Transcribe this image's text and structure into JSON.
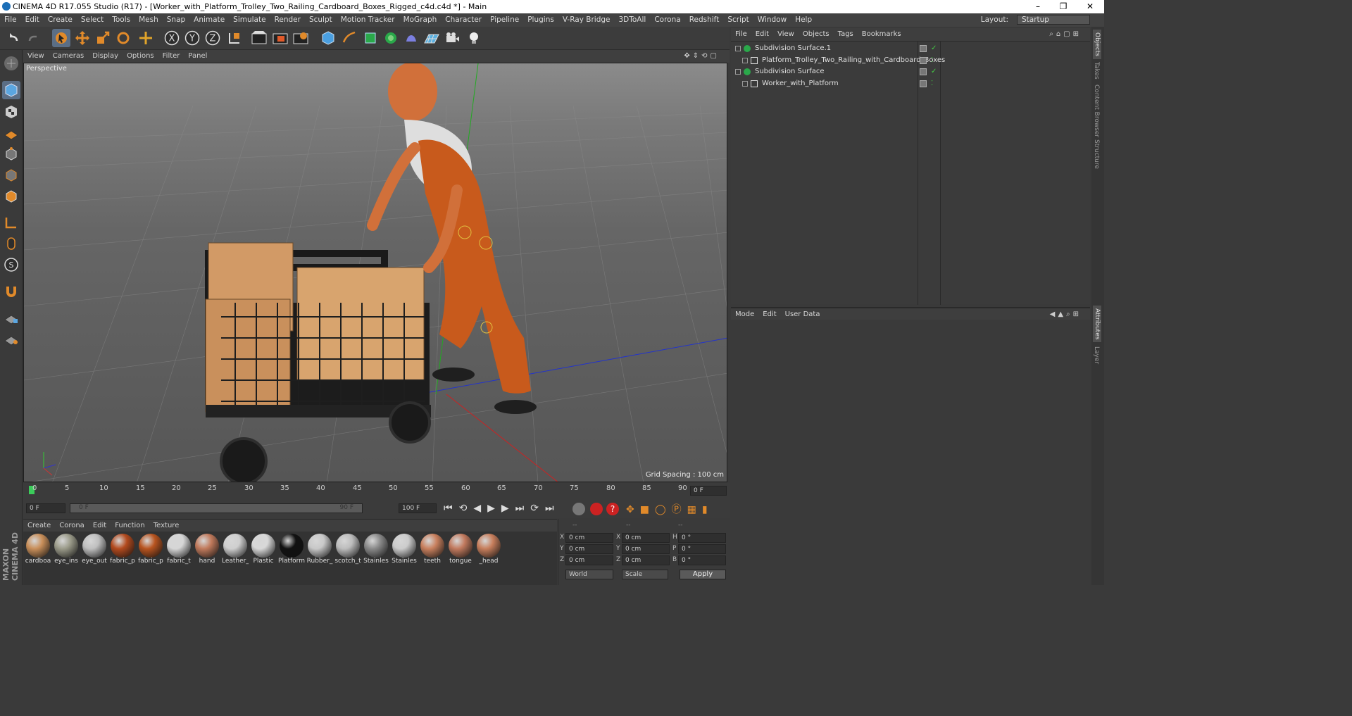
{
  "window": {
    "title": "CINEMA 4D R17.055 Studio (R17) - [Worker_with_Platform_Trolley_Two_Railing_Cardboard_Boxes_Rigged_c4d.c4d *] - Main",
    "minimize": "–",
    "maximize": "❐",
    "close": "✕"
  },
  "menu": [
    "File",
    "Edit",
    "Create",
    "Select",
    "Tools",
    "Mesh",
    "Snap",
    "Animate",
    "Simulate",
    "Render",
    "Sculpt",
    "Motion Tracker",
    "MoGraph",
    "Character",
    "Pipeline",
    "Plugins",
    "V-Ray Bridge",
    "3DToAll",
    "Corona",
    "Redshift",
    "Script",
    "Window",
    "Help"
  ],
  "layout": {
    "label": "Layout:",
    "value": "Startup"
  },
  "toolbar": {
    "x": "X",
    "y": "Y",
    "z": "Z"
  },
  "viewport": {
    "menu": [
      "View",
      "Cameras",
      "Display",
      "Options",
      "Filter",
      "Panel"
    ],
    "label": "Perspective",
    "grid_spacing": "Grid Spacing : 100 cm"
  },
  "timeline": {
    "ticks": [
      "0",
      "5",
      "10",
      "15",
      "20",
      "25",
      "30",
      "35",
      "40",
      "45",
      "50",
      "55",
      "60",
      "65",
      "70",
      "75",
      "80",
      "85",
      "90"
    ],
    "current": "0 F"
  },
  "transport": {
    "start": "0 F",
    "range_start": "0 F",
    "range_end": "90 F",
    "end": "100 F"
  },
  "materials": {
    "menu": [
      "Create",
      "Corona",
      "Edit",
      "Function",
      "Texture"
    ],
    "items": [
      {
        "name": "cardboa",
        "color": "#c98f5a"
      },
      {
        "name": "eye_ins",
        "color": "#9b9b8a"
      },
      {
        "name": "eye_out",
        "color": "#bfbfbf"
      },
      {
        "name": "fabric_p",
        "color": "#b34a1e"
      },
      {
        "name": "fabric_p",
        "color": "#b8541f"
      },
      {
        "name": "fabric_t",
        "color": "#d6d6d6"
      },
      {
        "name": "hand",
        "color": "#c17a5c"
      },
      {
        "name": "Leather_",
        "color": "#cfcfcf"
      },
      {
        "name": "Plastic",
        "color": "#d8d8d8"
      },
      {
        "name": "Platform",
        "color": "#111111"
      },
      {
        "name": "Rubber_",
        "color": "#c8c8c8"
      },
      {
        "name": "scotch_t",
        "color": "#bdbdbd"
      },
      {
        "name": "Stainles",
        "color": "#8a8a8a"
      },
      {
        "name": "Stainles",
        "color": "#cccccc"
      },
      {
        "name": "teeth",
        "color": "#c9805e"
      },
      {
        "name": "tongue",
        "color": "#c27a5e"
      },
      {
        "name": "_head",
        "color": "#c77e5c"
      }
    ]
  },
  "coords": {
    "header": [
      "--",
      "--",
      "--"
    ],
    "rows": [
      [
        "X",
        "0 cm",
        "X",
        "0 cm",
        "H",
        "0 °"
      ],
      [
        "Y",
        "0 cm",
        "Y",
        "0 cm",
        "P",
        "0 °"
      ],
      [
        "Z",
        "0 cm",
        "Z",
        "0 cm",
        "B",
        "0 °"
      ]
    ],
    "world": "World",
    "scale": "Scale",
    "apply": "Apply"
  },
  "objects": {
    "menu": [
      "File",
      "Edit",
      "View",
      "Objects",
      "Tags",
      "Bookmarks"
    ],
    "rows": [
      {
        "name": "Subdivision Surface.1",
        "indent": 0,
        "type": "subdiv"
      },
      {
        "name": "Platform_Trolley_Two_Railing_with_Cardboard_Boxes",
        "indent": 1,
        "type": "null"
      },
      {
        "name": "Subdivision Surface",
        "indent": 0,
        "type": "subdiv"
      },
      {
        "name": "Worker_with_Platform",
        "indent": 1,
        "type": "null"
      }
    ]
  },
  "attributes": {
    "menu": [
      "Mode",
      "Edit",
      "User Data"
    ]
  },
  "right_tabs": [
    "Objects",
    "Takes",
    "Content Browser",
    "Structure",
    "Attributes",
    "Layer"
  ],
  "brand": "MAXON CINEMA 4D"
}
